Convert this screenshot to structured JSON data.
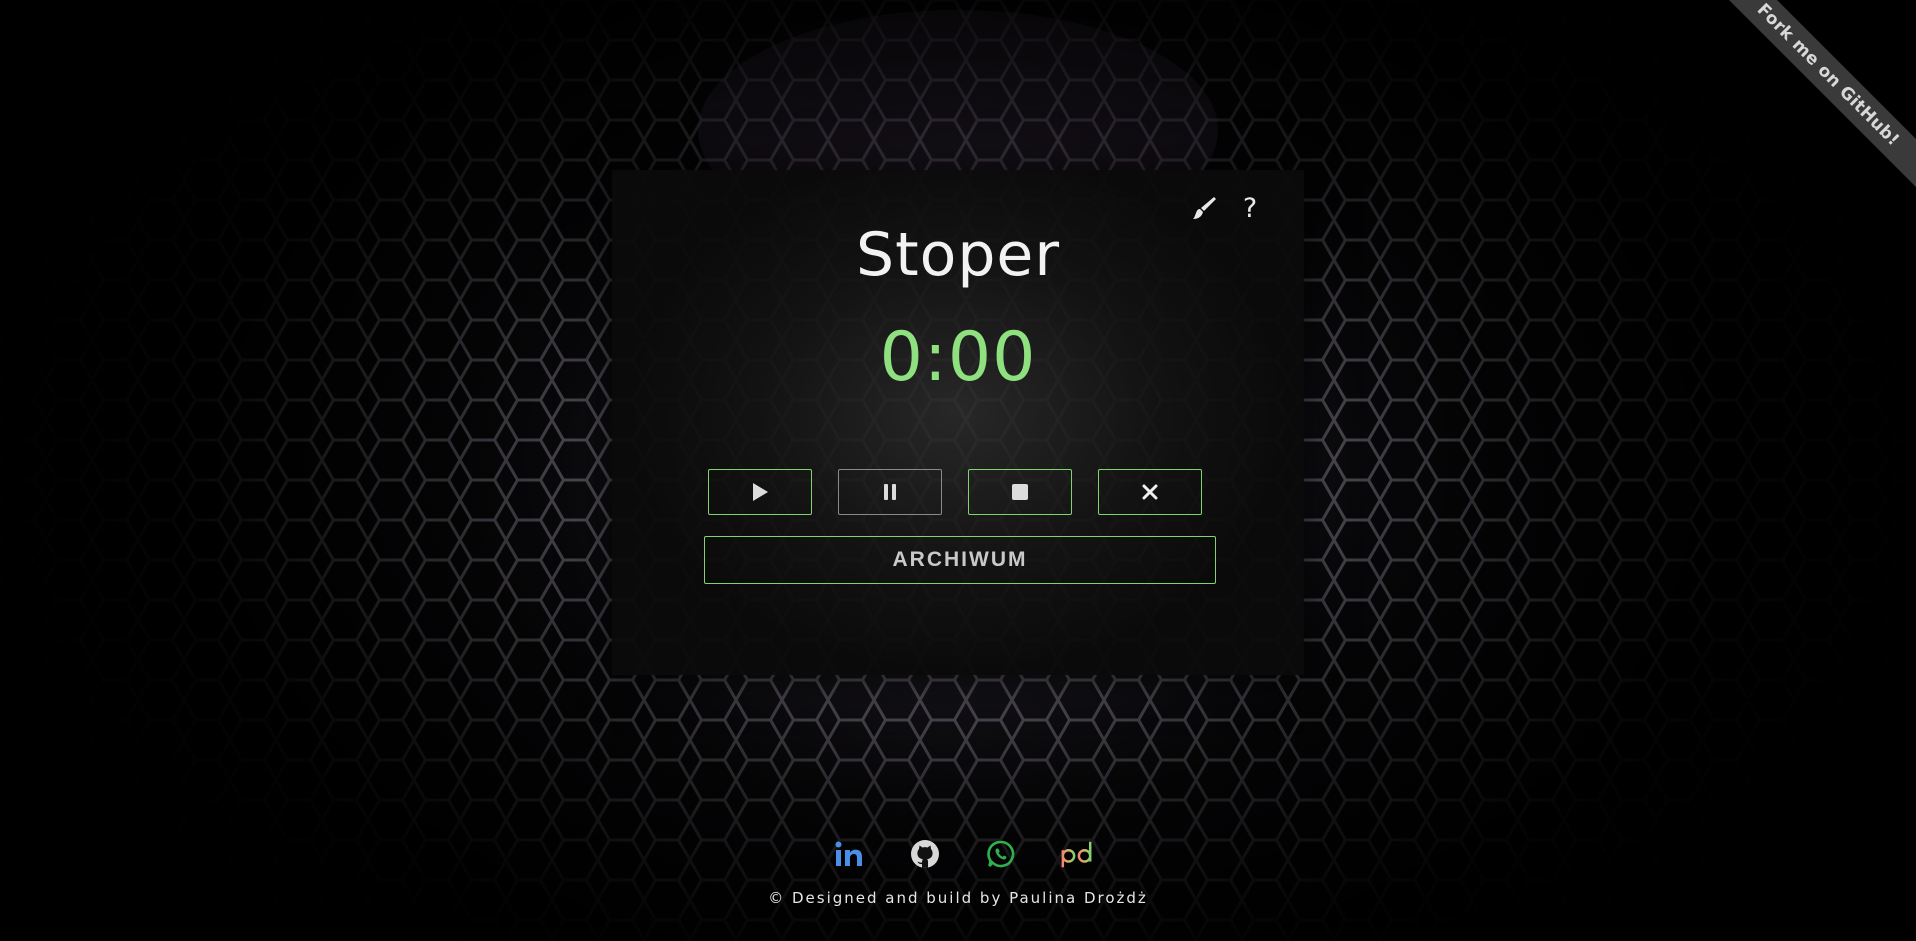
{
  "ribbon": {
    "label": "Fork me on GitHub!"
  },
  "card": {
    "title": "Stoper",
    "time": "0:00",
    "tools": {
      "brush_icon": "brush-icon",
      "help_label": "?"
    },
    "controls": [
      {
        "name": "start",
        "icon": "play-icon"
      },
      {
        "name": "pause",
        "icon": "pause-icon"
      },
      {
        "name": "stop",
        "icon": "stop-icon"
      },
      {
        "name": "reset",
        "icon": "close-icon"
      }
    ],
    "archive_label": "ARCHIWUM"
  },
  "social": [
    {
      "name": "linkedin",
      "icon": "linkedin-icon",
      "color": "#4a8ee6"
    },
    {
      "name": "github",
      "icon": "github-icon",
      "color": "#d8d8d8"
    },
    {
      "name": "whatsapp",
      "icon": "whatsapp-icon",
      "color": "#2fb24d"
    },
    {
      "name": "pd",
      "icon": "pd-logo-icon",
      "color": "#e69a6a"
    }
  ],
  "footer": {
    "text": "© Designed and build by Paulina Drożdż"
  },
  "colors": {
    "accent": "#8fe07e",
    "button_border": "#7fd46e",
    "card_bg": "#141414"
  }
}
